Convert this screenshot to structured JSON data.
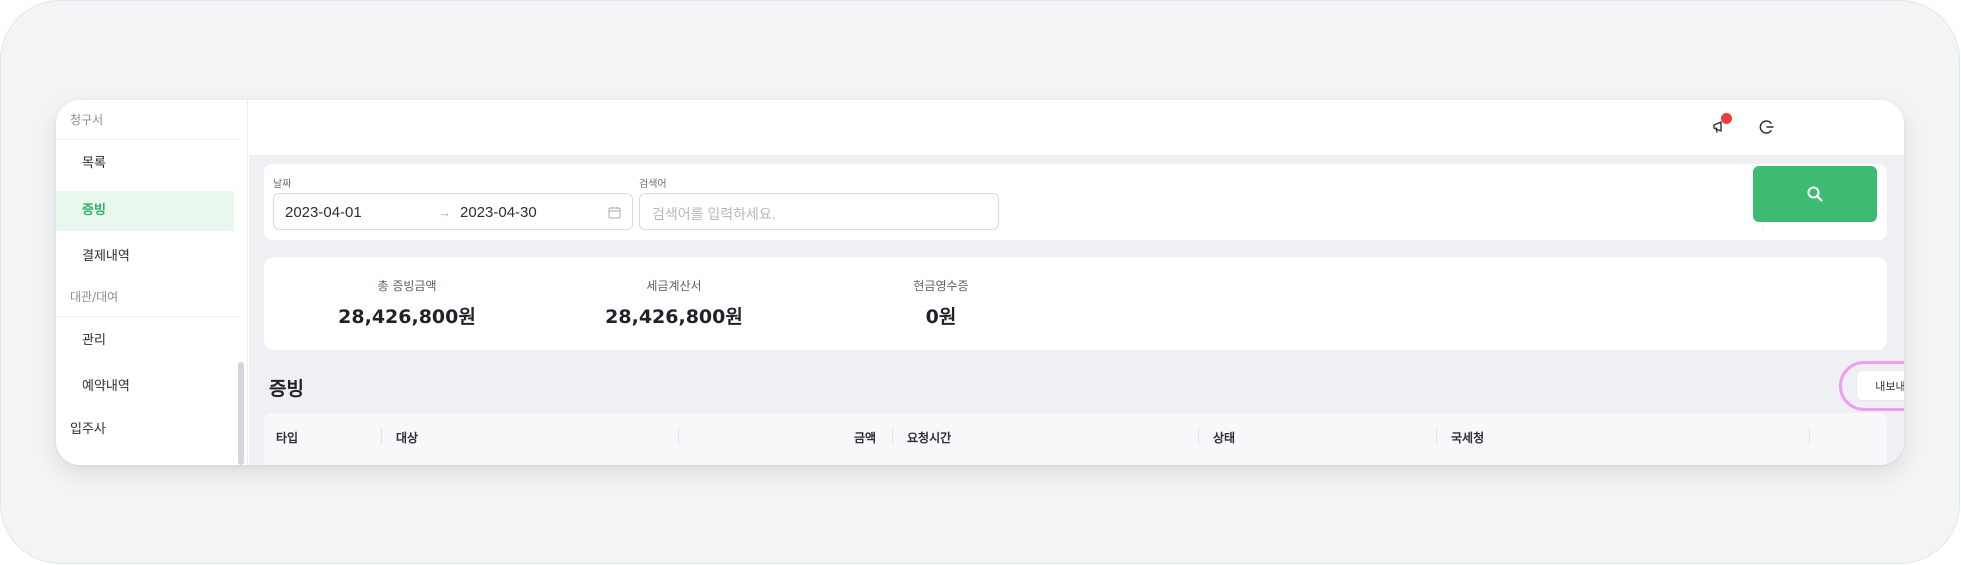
{
  "sidebar": {
    "sections": [
      {
        "label": "청구서"
      },
      {
        "label": "대관/대여"
      }
    ],
    "items": [
      {
        "label": "목록"
      },
      {
        "label": "증빙"
      },
      {
        "label": "결제내역"
      },
      {
        "label": "관리"
      },
      {
        "label": "예약내역"
      }
    ],
    "bottom_item": "입주사"
  },
  "filter": {
    "date_label": "날짜",
    "date_start": "2023-04-01",
    "date_arrow": "→",
    "date_end": "2023-04-30",
    "search_label": "검색어",
    "search_placeholder": "검색어를 입력하세요."
  },
  "summary": [
    {
      "label": "총 증빙금액",
      "value": "28,426,800원"
    },
    {
      "label": "세금계산서",
      "value": "28,426,800원"
    },
    {
      "label": "현금영수증",
      "value": "0원"
    }
  ],
  "section_title": "증빙",
  "export_label": "내보내기",
  "table": {
    "columns": [
      "타입",
      "대상",
      "금액",
      "요청시간",
      "상태",
      "국세청"
    ]
  },
  "colors": {
    "accent": "#3dbb73",
    "active_bg": "#e8f8ee",
    "notification": "#ef3d3d",
    "highlight": "#ef9cf1"
  }
}
